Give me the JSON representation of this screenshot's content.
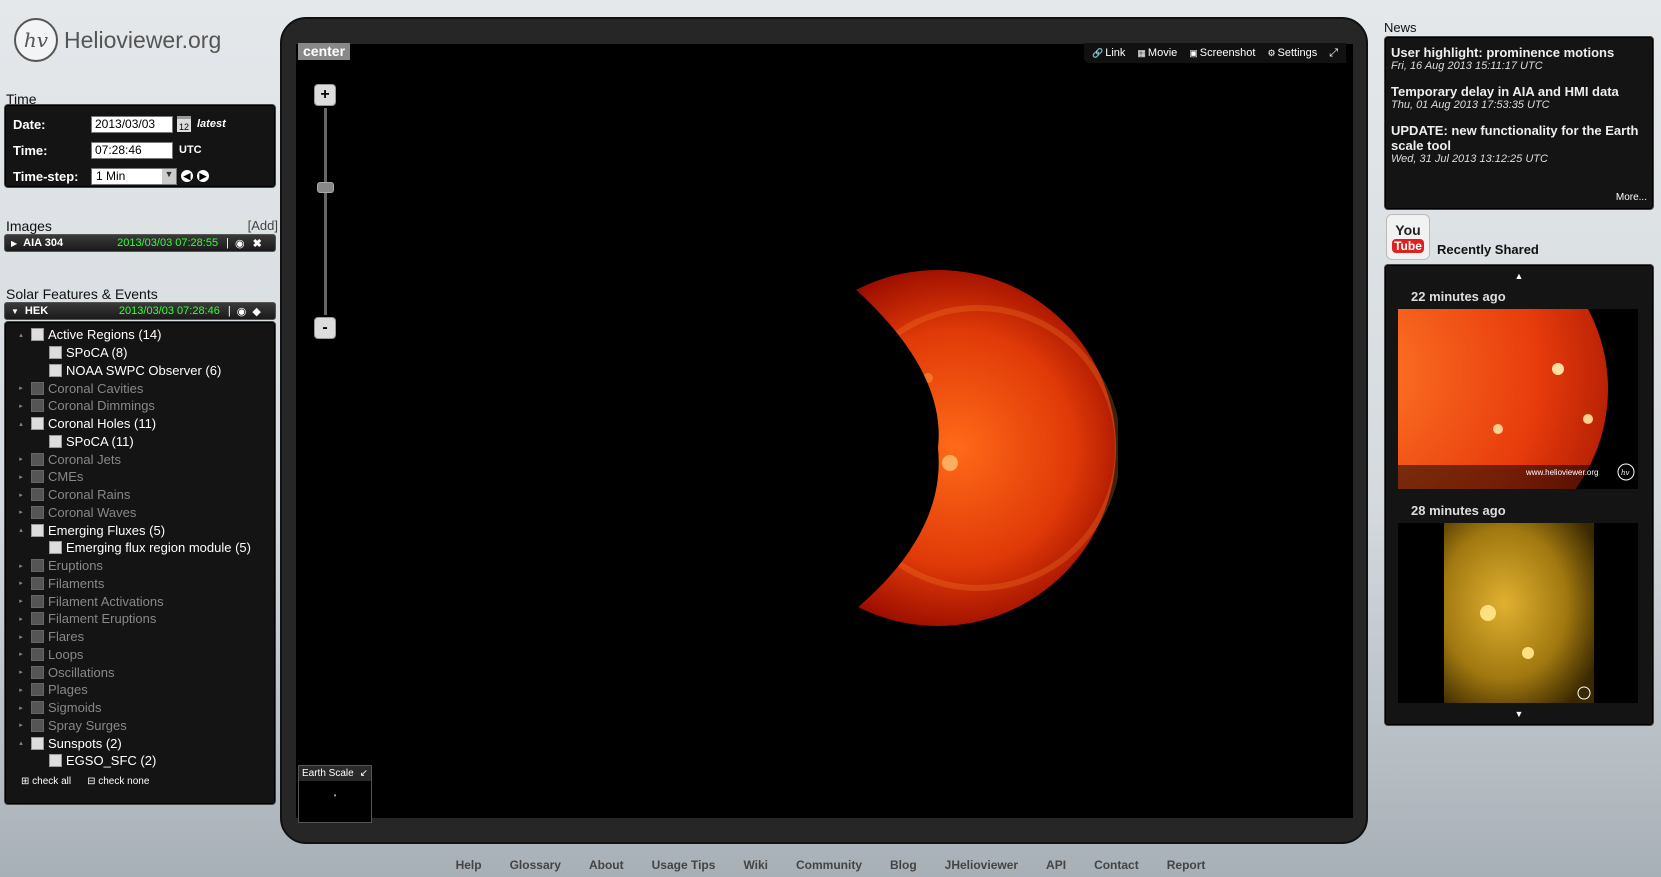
{
  "logo": {
    "mark": "hv",
    "name": "Helioviewer.org"
  },
  "time": {
    "title": "Time",
    "date_label": "Date:",
    "date_value": "2013/03/03",
    "calendar_day": "12",
    "latest_label": "latest",
    "time_label": "Time:",
    "time_value": "07:28:46",
    "utc_label": "UTC",
    "step_label": "Time-step:",
    "step_value": "1 Min"
  },
  "images": {
    "title": "Images",
    "add_label": "[Add]",
    "layer": {
      "name": "AIA 304",
      "timestamp": "2013/03/03 07:28:55"
    }
  },
  "features": {
    "title": "Solar Features & Events",
    "source": {
      "name": "HEK",
      "timestamp": "2013/03/03 07:28:46"
    },
    "items": [
      {
        "label": "Active Regions (14)",
        "enabled": true,
        "caret": "▴"
      },
      {
        "label": "SPoCA (8)",
        "enabled": true,
        "child": true
      },
      {
        "label": "NOAA SWPC Observer (6)",
        "enabled": true,
        "child": true
      },
      {
        "label": "Coronal Cavities",
        "enabled": false,
        "caret": "▸"
      },
      {
        "label": "Coronal Dimmings",
        "enabled": false,
        "caret": "▸"
      },
      {
        "label": "Coronal Holes (11)",
        "enabled": true,
        "caret": "▴"
      },
      {
        "label": "SPoCA (11)",
        "enabled": true,
        "child": true
      },
      {
        "label": "Coronal Jets",
        "enabled": false,
        "caret": "▸"
      },
      {
        "label": "CMEs",
        "enabled": false,
        "caret": "▸"
      },
      {
        "label": "Coronal Rains",
        "enabled": false,
        "caret": "▸"
      },
      {
        "label": "Coronal Waves",
        "enabled": false,
        "caret": "▸"
      },
      {
        "label": "Emerging Fluxes (5)",
        "enabled": true,
        "caret": "▴"
      },
      {
        "label": "Emerging flux region module (5)",
        "enabled": true,
        "child": true
      },
      {
        "label": "Eruptions",
        "enabled": false,
        "caret": "▸"
      },
      {
        "label": "Filaments",
        "enabled": false,
        "caret": "▸"
      },
      {
        "label": "Filament Activations",
        "enabled": false,
        "caret": "▸"
      },
      {
        "label": "Filament Eruptions",
        "enabled": false,
        "caret": "▸"
      },
      {
        "label": "Flares",
        "enabled": false,
        "caret": "▸"
      },
      {
        "label": "Loops",
        "enabled": false,
        "caret": "▸"
      },
      {
        "label": "Oscillations",
        "enabled": false,
        "caret": "▸"
      },
      {
        "label": "Plages",
        "enabled": false,
        "caret": "▸"
      },
      {
        "label": "Sigmoids",
        "enabled": false,
        "caret": "▸"
      },
      {
        "label": "Spray Surges",
        "enabled": false,
        "caret": "▸"
      },
      {
        "label": "Sunspots (2)",
        "enabled": true,
        "caret": "▴"
      },
      {
        "label": "EGSO_SFC (2)",
        "enabled": true,
        "child": true
      }
    ],
    "check_all": "check all",
    "check_none": "check none"
  },
  "viewport": {
    "center_label": "center",
    "toolbar": {
      "link": "Link",
      "movie": "Movie",
      "screenshot": "Screenshot",
      "settings": "Settings"
    },
    "zoom_in": "+",
    "zoom_out": "-",
    "earth_scale_label": "Earth Scale"
  },
  "news": {
    "title": "News",
    "items": [
      {
        "headline": "User highlight: prominence motions",
        "date": "Fri, 16 Aug 2013 15:11:17 UTC"
      },
      {
        "headline": "Temporary delay in AIA and HMI data",
        "date": "Thu, 01 Aug 2013 17:53:35 UTC"
      },
      {
        "headline": "UPDATE: new functionality for the Earth scale tool",
        "date": "Wed, 31 Jul 2013 13:12:25 UTC"
      }
    ],
    "more": "More..."
  },
  "youtube": {
    "you": "You",
    "tube": "Tube"
  },
  "shared": {
    "title": "Recently Shared",
    "items": [
      {
        "time": "22 minutes ago",
        "watermark": "www.helioviewer.org"
      },
      {
        "time": "28 minutes ago"
      }
    ]
  },
  "footer": {
    "links": [
      "Help",
      "Glossary",
      "About",
      "Usage Tips",
      "Wiki",
      "Community",
      "Blog",
      "JHelioviewer",
      "API",
      "Contact",
      "Report"
    ]
  },
  "colors": {
    "sun_core": "#ff5a10",
    "sun_edge": "#b01000",
    "timestamp_green": "#33ff33"
  }
}
